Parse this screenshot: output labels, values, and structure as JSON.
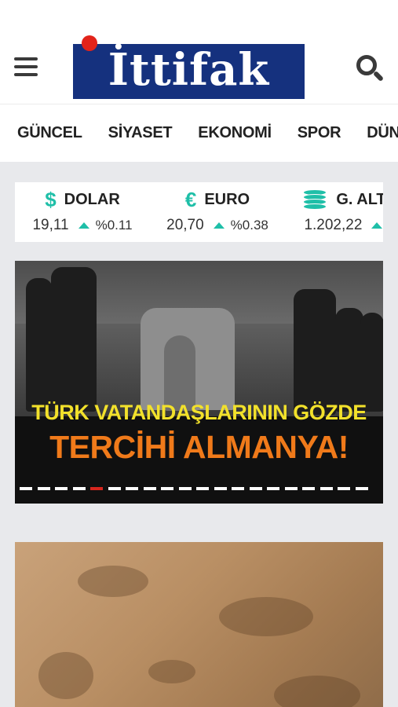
{
  "header": {
    "logo_text": "İttifak",
    "menu_icon": "hamburger-menu-icon",
    "search_icon": "search-icon",
    "brand_color": "#15317e",
    "accent_color": "#e2231a"
  },
  "nav": {
    "items": [
      "GÜNCEL",
      "SİYASET",
      "EKONOMİ",
      "SPOR",
      "DÜNYA"
    ]
  },
  "rates": [
    {
      "icon": "dollar-icon",
      "symbol": "$",
      "name": "DOLAR",
      "value": "19,11",
      "change": "%0.11",
      "trend": "up"
    },
    {
      "icon": "euro-icon",
      "symbol": "€",
      "name": "EURO",
      "value": "20,70",
      "change": "%0.38",
      "trend": "up"
    },
    {
      "icon": "gold-coins-icon",
      "symbol": "",
      "name": "G. ALTIN",
      "value": "1.202,22",
      "change": "%",
      "trend": "up"
    }
  ],
  "headline": {
    "line1": "TÜRK VATANDAŞLARININ GÖZDE",
    "line2": "TERCİHİ ALMANYA!",
    "slide_count": 20,
    "active_slide": 4
  },
  "colors": {
    "up_trend": "#1fbfa8",
    "headline_yellow": "#f2e12b",
    "headline_orange": "#f07a1a"
  }
}
